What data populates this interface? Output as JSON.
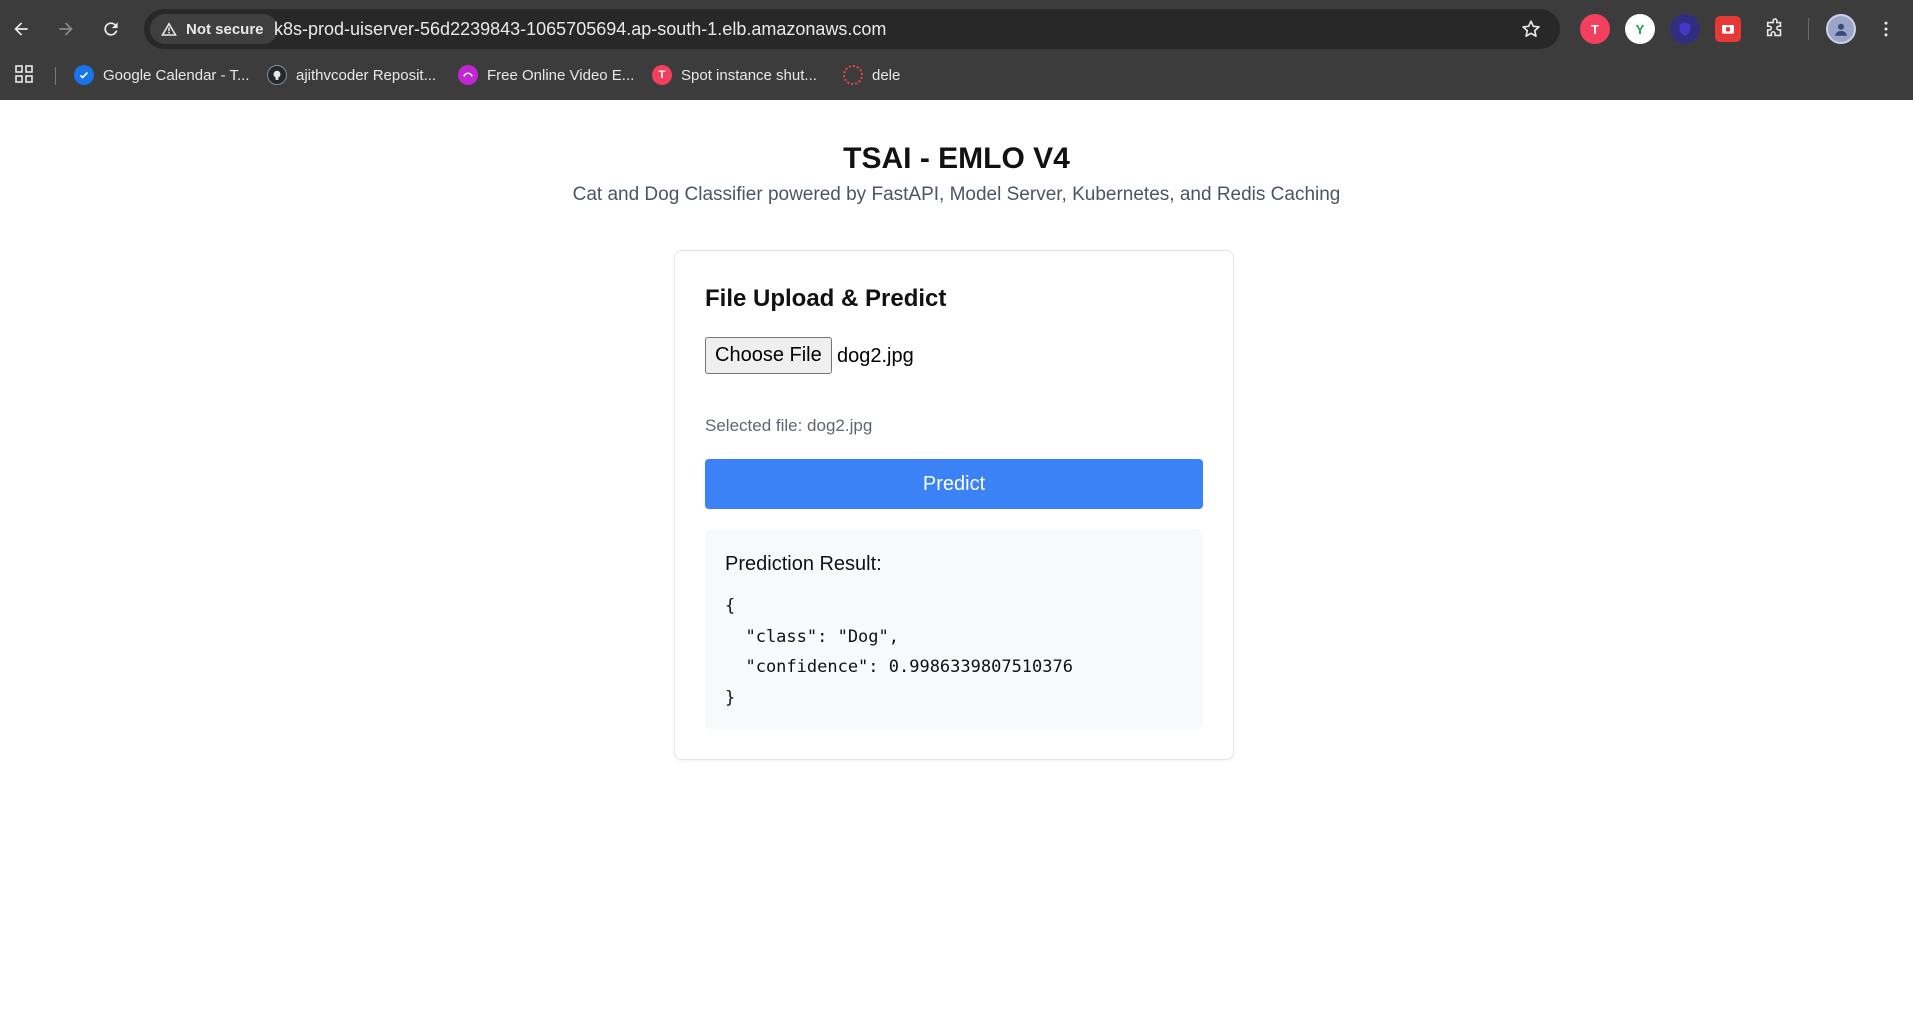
{
  "browser": {
    "security_label": "Not secure",
    "url": "k8s-prod-uiserver-56d2239843-1065705694.ap-south-1.elb.amazonaws.com",
    "bookmarks": [
      {
        "label": "Google Calendar - T...",
        "icon": "calendar-icon",
        "color": "#1a73e8"
      },
      {
        "label": "ajithvcoder Reposit...",
        "icon": "github-icon",
        "color": "#24292f"
      },
      {
        "label": "Free Online Video E...",
        "icon": "video-editor-icon",
        "color": "#c026d3"
      },
      {
        "label": "Spot instance shut...",
        "icon": "tab-icon",
        "color": "#f43f5e"
      },
      {
        "label": "dele",
        "icon": "spinner-icon",
        "color": "#ef4444"
      }
    ],
    "extensions": [
      {
        "name": "t-extension-icon",
        "glyph": "T",
        "color": "#f43f5e"
      },
      {
        "name": "y-extension-icon",
        "glyph": "Y",
        "color": "#ffffff"
      },
      {
        "name": "shield-extension-icon",
        "glyph": "",
        "color": "#3730a3"
      },
      {
        "name": "screenshot-extension-icon",
        "glyph": "",
        "color": "#e53935"
      }
    ]
  },
  "page": {
    "title": "TSAI - EMLO V4",
    "subtitle": "Cat and Dog Classifier powered by FastAPI, Model Server, Kubernetes, and Redis Caching"
  },
  "card": {
    "title": "File Upload & Predict",
    "choose_file_label": "Choose File",
    "file_name": "dog2.jpg",
    "selected_file_text": "Selected file: dog2.jpg",
    "predict_label": "Predict",
    "result_label": "Prediction Result:",
    "result_json": "{\n  \"class\": \"Dog\",\n  \"confidence\": 0.9986339807510376\n}"
  },
  "colors": {
    "accent": "#3b82f6",
    "result_bg": "#f8f9fa",
    "chrome_bg": "#3c3c3c"
  }
}
